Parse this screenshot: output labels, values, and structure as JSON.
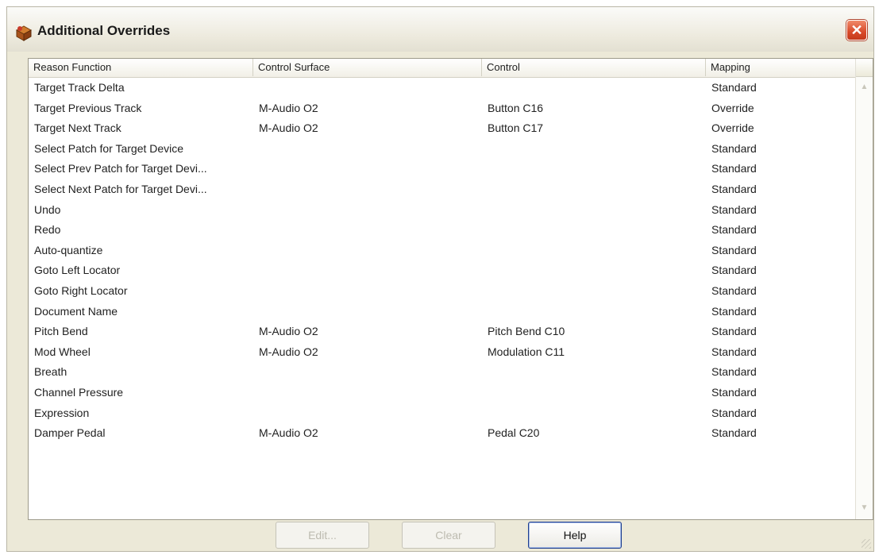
{
  "window": {
    "title": "Additional Overrides",
    "close_label": "✕"
  },
  "table": {
    "columns": [
      "Reason Function",
      "Control Surface",
      "Control",
      "Mapping"
    ],
    "rows": [
      {
        "function": "Target Track Delta",
        "surface": "",
        "control": "",
        "mapping": "Standard"
      },
      {
        "function": "Target Previous Track",
        "surface": "M-Audio O2",
        "control": "Button C16",
        "mapping": "Override"
      },
      {
        "function": "Target Next Track",
        "surface": "M-Audio O2",
        "control": "Button C17",
        "mapping": "Override"
      },
      {
        "function": "Select Patch for Target Device",
        "surface": "",
        "control": "",
        "mapping": "Standard"
      },
      {
        "function": "Select Prev Patch for Target Devi...",
        "surface": "",
        "control": "",
        "mapping": "Standard"
      },
      {
        "function": "Select Next Patch for Target Devi...",
        "surface": "",
        "control": "",
        "mapping": "Standard"
      },
      {
        "function": "Undo",
        "surface": "",
        "control": "",
        "mapping": "Standard"
      },
      {
        "function": "Redo",
        "surface": "",
        "control": "",
        "mapping": "Standard"
      },
      {
        "function": "Auto-quantize",
        "surface": "",
        "control": "",
        "mapping": "Standard"
      },
      {
        "function": "Goto Left Locator",
        "surface": "",
        "control": "",
        "mapping": "Standard"
      },
      {
        "function": "Goto Right Locator",
        "surface": "",
        "control": "",
        "mapping": "Standard"
      },
      {
        "function": "Document Name",
        "surface": "",
        "control": "",
        "mapping": "Standard"
      },
      {
        "function": "Pitch Bend",
        "surface": "M-Audio O2",
        "control": "Pitch Bend C10",
        "mapping": "Standard"
      },
      {
        "function": "Mod Wheel",
        "surface": "M-Audio O2",
        "control": "Modulation C11",
        "mapping": "Standard"
      },
      {
        "function": "Breath",
        "surface": "",
        "control": "",
        "mapping": "Standard"
      },
      {
        "function": "Channel Pressure",
        "surface": "",
        "control": "",
        "mapping": "Standard"
      },
      {
        "function": "Expression",
        "surface": "",
        "control": "",
        "mapping": "Standard"
      },
      {
        "function": "Damper Pedal",
        "surface": "M-Audio O2",
        "control": "Pedal C20",
        "mapping": "Standard"
      }
    ]
  },
  "buttons": {
    "edit": "Edit...",
    "clear": "Clear",
    "help": "Help"
  },
  "scrollbar": {
    "up_icon": "▲",
    "down_icon": "▼"
  },
  "colors": {
    "dialog_bg": "#ece9d8",
    "close_button": "#d84a2a"
  }
}
